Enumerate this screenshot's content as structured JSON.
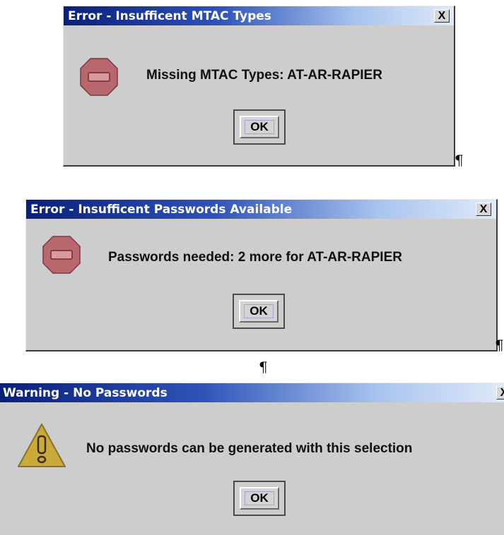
{
  "dialogs": [
    {
      "title": "Error - Insufficent MTAC Types",
      "close_label": "X",
      "icon": "stop-icon",
      "message": "Missing MTAC Types: AT-AR-RAPIER",
      "ok_label": "OK"
    },
    {
      "title": "Error - Insufficent Passwords Available",
      "close_label": "X",
      "icon": "stop-icon",
      "message": "Passwords needed: 2 more for AT-AR-RAPIER",
      "ok_label": "OK"
    },
    {
      "title": "Warning - No Passwords",
      "close_label": "X",
      "icon": "warning-icon",
      "message": "No passwords can be generated with this selection",
      "ok_label": "OK"
    }
  ],
  "pilcrows": [
    "¶",
    "¶",
    "¶"
  ],
  "colors": {
    "titlebar_start": "#0a1f7a",
    "titlebar_end": "#dfe9f9",
    "dialog_bg": "#cdcdcd",
    "stop_icon": "#b8686c",
    "warning_icon": "#c9aa3a"
  }
}
